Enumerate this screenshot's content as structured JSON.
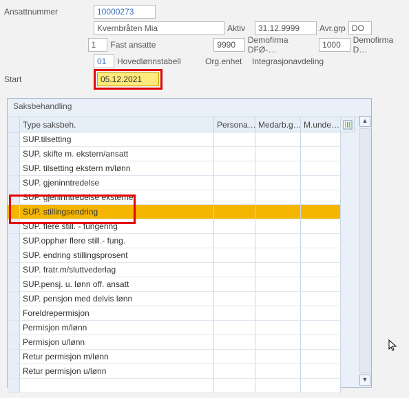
{
  "header": {
    "ansattnummer_label": "Ansattnummer",
    "ansattnummer": "10000273",
    "name": "Kvernbråten Mia",
    "status": "Aktiv",
    "end_date": "31.12.9999",
    "avrgrp_label": "Avr.grp",
    "do_label": "DO",
    "grp1_code": "1",
    "grp1_text": "Fast ansatte",
    "grp1_num": "9990",
    "grp1_org": "Demofirma DFØ-…",
    "grp1_num2": "1000",
    "grp1_org2": "Demofirma D…",
    "grp2_code": "01",
    "grp2_text": "Hovedlønnstabell",
    "org_enhet_label": "Org.enhet",
    "org_enhet": "Integrasjonavdeling",
    "start_label": "Start",
    "start_date": "05.12.2021"
  },
  "table": {
    "title": "Saksbehandling",
    "columns": {
      "type": "Type saksbeh.",
      "persona": "Persona…",
      "medarb": "Medarb.g…",
      "munde": "M.unde…"
    },
    "rows": [
      "SUP.tilsetting",
      "SUP. skifte m. ekstern/ansatt",
      "SUP. tilsetting ekstern m/lønn",
      "SUP. gjeninntredelse",
      "SUP. gjeninntredelse eksterne",
      "SUP. stillingsendring",
      "SUP. flere still. - fungering",
      "SUP.opphør flere still.- fung.",
      "SUP. endring stillingsprosent",
      "SUP. fratr.m/sluttvederlag",
      "SUP.pensj. u. lønn off. ansatt",
      "SUP. pensjon med delvis lønn",
      "Foreldrepermisjon",
      "Permisjon m/lønn",
      "Permisjon u/lønn",
      "Retur permisjon m/lønn",
      "Retur permisjon u/lønn",
      ""
    ],
    "selected_index": 5
  }
}
